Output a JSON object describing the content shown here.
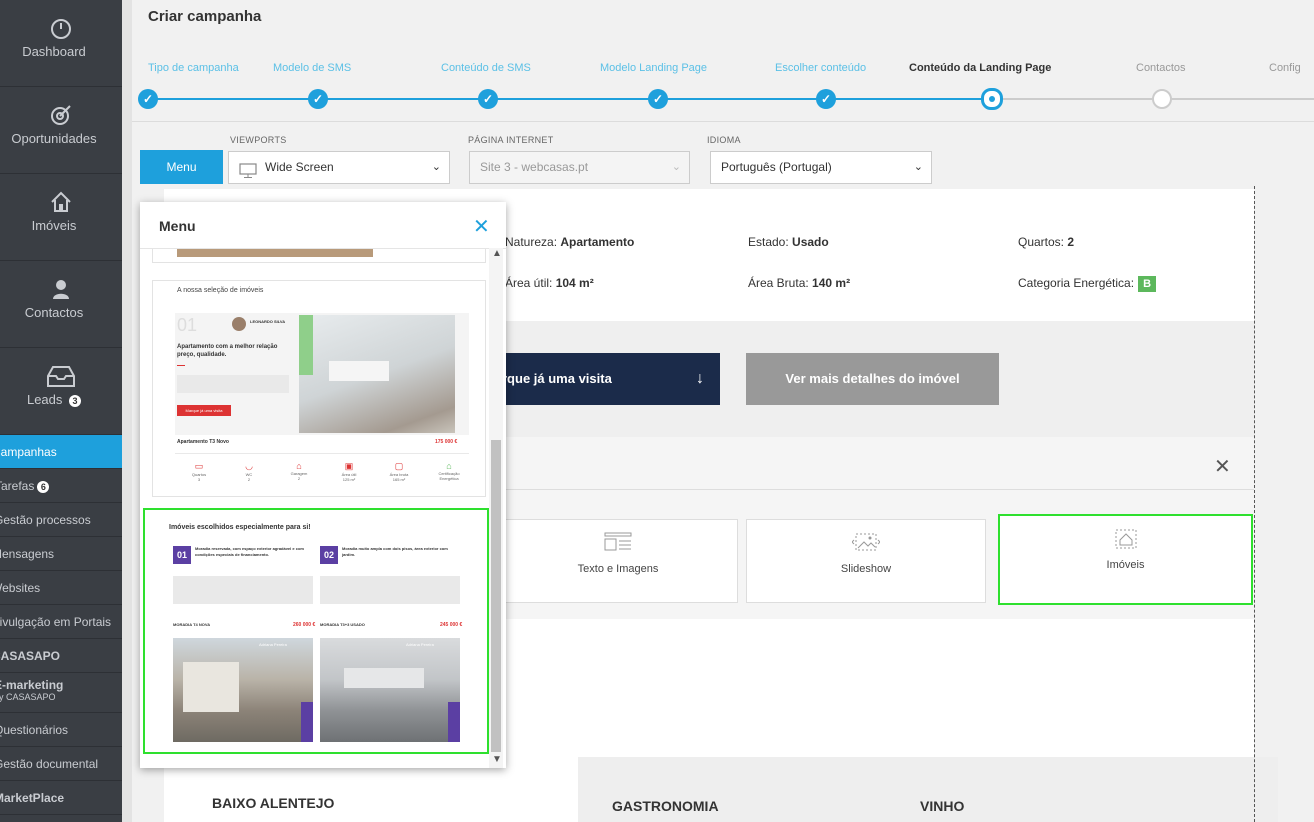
{
  "sidebar": {
    "big_items": [
      {
        "label": "Dashboard",
        "icon": "dashboard-gauge-icon"
      },
      {
        "label": "Oportunidades",
        "icon": "target-icon"
      },
      {
        "label": "Imóveis",
        "icon": "house-icon"
      },
      {
        "label": "Contactos",
        "icon": "person-icon"
      },
      {
        "label": "Leads",
        "icon": "inbox-icon",
        "badge": "3"
      }
    ],
    "small_items": [
      {
        "label": "Campanhas",
        "active": true
      },
      {
        "label": "Tarefas",
        "badge": "6"
      },
      {
        "label": "Gestão processos"
      },
      {
        "label": "Mensagens"
      },
      {
        "label": "Websites"
      },
      {
        "label": "Divulgação em Portais"
      },
      {
        "label": "CASASAPO"
      }
    ],
    "emarketing_label": "E-marketing",
    "emarketing_sub": "by CASASAPO",
    "after_items": [
      {
        "label": "Questionários"
      },
      {
        "label": "Gestão documental"
      },
      {
        "label": "MarketPlace"
      }
    ]
  },
  "page": {
    "title": "Criar campanha"
  },
  "steps": [
    {
      "label": "Tipo de campanha",
      "state": "done"
    },
    {
      "label": "Modelo de SMS",
      "state": "done"
    },
    {
      "label": "Conteúdo de SMS",
      "state": "done"
    },
    {
      "label": "Modelo Landing Page",
      "state": "done"
    },
    {
      "label": "Escolher conteúdo",
      "state": "done"
    },
    {
      "label": "Conteúdo da Landing Page",
      "state": "current"
    },
    {
      "label": "Contactos",
      "state": "future"
    },
    {
      "label": "Config",
      "state": "future"
    }
  ],
  "toolbar": {
    "menu_button": "Menu",
    "viewports_label": "VIEWPORTS",
    "viewports_value": "Wide Screen",
    "pagina_label": "PÁGINA INTERNET",
    "pagina_value": "Site 3 - webcasas.pt",
    "idioma_label": "IDIOMA",
    "idioma_value": "Português (Portugal)"
  },
  "property": {
    "natureza_label": "Natureza:",
    "natureza_value": "Apartamento",
    "estado_label": "Estado:",
    "estado_value": "Usado",
    "quartos_label": "Quartos:",
    "quartos_value": "2",
    "area_util_label": "Área útil:",
    "area_util_value": "104 m²",
    "area_bruta_label": "Área Bruta:",
    "area_bruta_value": "140 m²",
    "categoria_label": "Categoria Energética:",
    "categoria_value": "B",
    "visit_button": "rque já uma visita",
    "details_button": "Ver mais detalhes do imóvel"
  },
  "blocks": {
    "cards": [
      {
        "label": "Texto e Imagens",
        "icon": "text-image-icon"
      },
      {
        "label": "Slideshow",
        "icon": "slideshow-icon"
      },
      {
        "label": "Imóveis",
        "icon": "property-house-icon",
        "selected": true
      }
    ]
  },
  "bottom": {
    "region": "BAIXO ALENTEJO",
    "gastronomia": "GASTRONOMIA",
    "vinho": "VINHO"
  },
  "menu_popup": {
    "title": "Menu",
    "thumb1": {
      "heading": "A nossa seleção de imóveis",
      "number": "01",
      "agent": "LEONARDO SILVA",
      "headline": "Apartamento com a melhor relação preço, qualidade.",
      "button": "Marque já uma visita",
      "listing": "Apartamento T3 Novo",
      "price": "175 000 €",
      "features": [
        "Quartos",
        "WC",
        "Garagem",
        "Área útil",
        "Área bruta",
        "Certificação Energética"
      ],
      "feature_values": [
        "3",
        "2",
        "2",
        "125 m²",
        "165 m²",
        ""
      ]
    },
    "thumb2": {
      "heading": "Imóveis escolhidos especialmente para si!",
      "n1": "01",
      "n1_text": "Moradia reservada, com espaço exterior agradável e com condições especiais de financiamento.",
      "n2": "02",
      "n2_text": "Moradia muito ampla com dois pisos, área exterior com jardim.",
      "l1_title": "MORADIA T4 NOVA",
      "l1_price": "260 000 €",
      "l2_title": "MORADIA T3+3 USADO",
      "l2_price": "245 000 €",
      "agent": "Adriana Pereira"
    }
  },
  "colors": {
    "accent": "#1ea0dc",
    "sidebar_bg": "#3a3e44",
    "selected_outline": "#2ee02e",
    "visit_button_bg": "#1b2b4a",
    "details_button_bg": "#999999",
    "energy_b": "#5cb85c"
  }
}
